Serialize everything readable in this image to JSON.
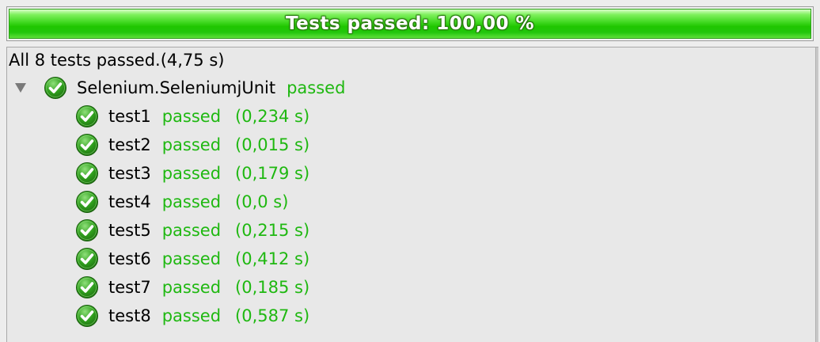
{
  "progress": {
    "label": "Tests passed: 100,00 %",
    "fraction": 1.0,
    "color": "#22c60c"
  },
  "summary": "All 8 tests passed.(4,75 s)",
  "suite": {
    "name": "Selenium.SeleniumjUnit",
    "status": "passed",
    "expanded": true,
    "icon": "check-circle-icon"
  },
  "tests": [
    {
      "name": "test1",
      "status": "passed",
      "time": "(0,234 s)"
    },
    {
      "name": "test2",
      "status": "passed",
      "time": "(0,015 s)"
    },
    {
      "name": "test3",
      "status": "passed",
      "time": "(0,179 s)"
    },
    {
      "name": "test4",
      "status": "passed",
      "time": "(0,0 s)"
    },
    {
      "name": "test5",
      "status": "passed",
      "time": "(0,215 s)"
    },
    {
      "name": "test6",
      "status": "passed",
      "time": "(0,412 s)"
    },
    {
      "name": "test7",
      "status": "passed",
      "time": "(0,185 s)"
    },
    {
      "name": "test8",
      "status": "passed",
      "time": "(0,587 s)"
    }
  ],
  "colors": {
    "passed_text": "#1fb811",
    "icon_green": "#2e9a1c"
  }
}
